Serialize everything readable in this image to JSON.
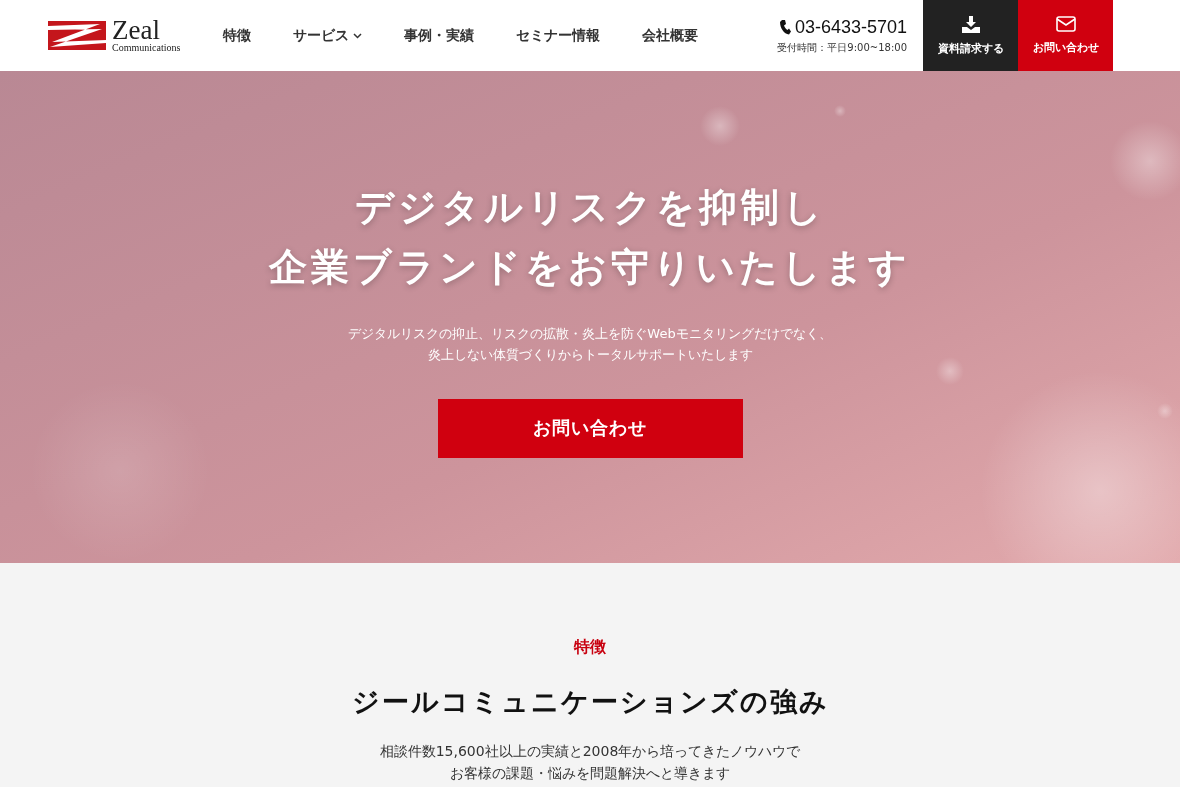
{
  "header": {
    "logo": {
      "name": "Zeal",
      "tagline": "Communications"
    },
    "nav": [
      {
        "label": "特徴",
        "dropdown": false
      },
      {
        "label": "サービス",
        "dropdown": true
      },
      {
        "label": "事例・実績",
        "dropdown": false
      },
      {
        "label": "セミナー情報",
        "dropdown": false
      },
      {
        "label": "会社概要",
        "dropdown": false
      }
    ],
    "phone": "03-6433-5701",
    "hours": "受付時間：平日9:00~18:00",
    "actions": [
      {
        "label": "資料請求する",
        "kind": "download"
      },
      {
        "label": "お問い合わせ",
        "kind": "mail"
      }
    ]
  },
  "hero": {
    "title_lines": [
      "デジタルリスクを抑制し",
      "企業ブランドをお守りいたします"
    ],
    "subtitle_lines": [
      "デジタルリスクの抑止、リスクの拡散・炎上を防ぐWebモニタリングだけでなく、",
      "炎上しない体質づくりからトータルサポートいたします"
    ],
    "button": "お問い合わせ"
  },
  "features": {
    "eyebrow": "特徴",
    "heading": "ジールコミュニケーションズの強み",
    "lines": [
      "相談件数15,600社以上の実績と2008年から培ってきたノウハウで",
      "お客様の課題・悩みを問題解決へと導きます"
    ]
  }
}
